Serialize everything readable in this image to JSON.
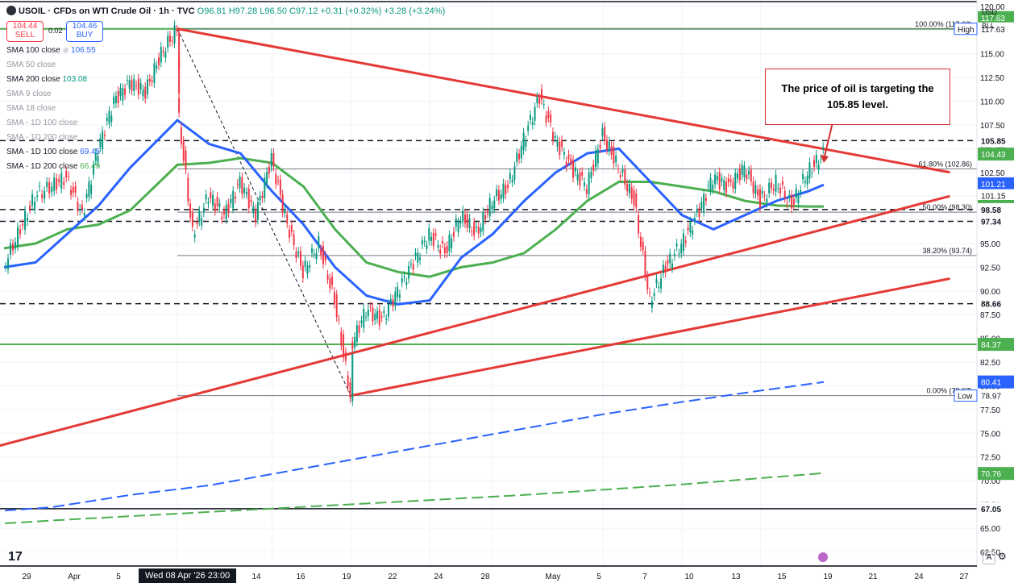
{
  "header": {
    "title": "USOIL · CFDs on WTI Crude Oil · 1h · TVC",
    "ohlc": "O96.81 H97.28 L96.50 C97.12 +0.31 (+0.32%) +3.28 (+3.24%)"
  },
  "trade": {
    "sell_price": "104.44",
    "sell_label": "SELL",
    "spread": "0.02",
    "buy_price": "104.46",
    "buy_label": "BUY"
  },
  "indicators": [
    {
      "label": "SMA 100 close",
      "value": "106.55",
      "style": "blue"
    },
    {
      "label": "SMA 50 close",
      "value": "",
      "style": "muted"
    },
    {
      "label": "SMA 200 close",
      "value": "103.08",
      "style": "green"
    },
    {
      "label": "SMA 9 close",
      "value": "",
      "style": "muted"
    },
    {
      "label": "SMA 18 close",
      "value": "",
      "style": "muted"
    },
    {
      "label": "SMA - 1D 100 close",
      "value": "",
      "style": "muted"
    },
    {
      "label": "SMA - 1D 200 close",
      "value": "",
      "style": "muted"
    },
    {
      "label": "SMA - 1D 100 close",
      "value": "69.45",
      "style": "blue"
    },
    {
      "label": "SMA - 1D 200 close",
      "value": "66.49",
      "style": "greenb"
    }
  ],
  "axis_units": [
    "USD",
    "BLL"
  ],
  "callout": "The price of oil is targeting the 105.85 level.",
  "date_badge": "Wed 08 Apr '26  23:00",
  "tv_logo": "17",
  "axis_button": "A",
  "colors": {
    "price_up": "#089981",
    "price_down": "#f23645",
    "sma_blue": "#2962ff",
    "sma_green": "#4caf50",
    "trendline": "#e53935",
    "axis_green": "#4caf50"
  },
  "chart_data": {
    "type": "line",
    "title": "USOIL · CFDs on WTI Crude Oil · 1h · TVC",
    "y_scale": "linear",
    "ylim": [
      61,
      120.5
    ],
    "y_ticks": [
      62.5,
      65.0,
      67.5,
      70.0,
      72.5,
      75.0,
      77.5,
      80.0,
      82.5,
      85.0,
      87.5,
      90.0,
      92.5,
      95.0,
      97.5,
      100.0,
      102.5,
      105.0,
      107.5,
      110.0,
      112.5,
      115.0,
      117.5,
      120.0
    ],
    "x_tick_labels": [
      "29",
      "Apr",
      "5",
      "14",
      "16",
      "19",
      "22",
      "24",
      "28",
      "May",
      "5",
      "7",
      "10",
      "13",
      "15",
      "19",
      "21",
      "24",
      "27"
    ],
    "price": [
      {
        "x": "Mar 28",
        "y": 92.5
      },
      {
        "x": "Mar 30",
        "y": 100.0
      },
      {
        "x": "Apr 1",
        "y": 102.0
      },
      {
        "x": "Apr 2",
        "y": 98.0
      },
      {
        "x": "Apr 3",
        "y": 105.0
      },
      {
        "x": "Apr 4",
        "y": 110.0
      },
      {
        "x": "Apr 5",
        "y": 112.0
      },
      {
        "x": "Apr 6",
        "y": 111.0
      },
      {
        "x": "Apr 7",
        "y": 115.0
      },
      {
        "x": "Apr 8",
        "y": 117.6
      },
      {
        "x": "Apr 8",
        "y": 110.0
      },
      {
        "x": "Apr 9",
        "y": 96.0
      },
      {
        "x": "Apr 10",
        "y": 100.0
      },
      {
        "x": "Apr 11",
        "y": 98.0
      },
      {
        "x": "Apr 12",
        "y": 101.5
      },
      {
        "x": "Apr 13",
        "y": 98.0
      },
      {
        "x": "Apr 14",
        "y": 104.0
      },
      {
        "x": "Apr 15",
        "y": 97.0
      },
      {
        "x": "Apr 16",
        "y": 92.0
      },
      {
        "x": "Apr 17",
        "y": 95.0
      },
      {
        "x": "Apr 18",
        "y": 89.0
      },
      {
        "x": "Apr 19",
        "y": 79.0
      },
      {
        "x": "Apr 19",
        "y": 84.0
      },
      {
        "x": "Apr 20",
        "y": 88.0
      },
      {
        "x": "Apr 21",
        "y": 87.0
      },
      {
        "x": "Apr 22",
        "y": 90.0
      },
      {
        "x": "Apr 23",
        "y": 93.0
      },
      {
        "x": "Apr 24",
        "y": 96.0
      },
      {
        "x": "Apr 25",
        "y": 94.0
      },
      {
        "x": "Apr 26",
        "y": 98.0
      },
      {
        "x": "Apr 27",
        "y": 96.0
      },
      {
        "x": "Apr 28",
        "y": 99.5
      },
      {
        "x": "Apr 29",
        "y": 101.0
      },
      {
        "x": "Apr 30",
        "y": 106.0
      },
      {
        "x": "May 1",
        "y": 110.5
      },
      {
        "x": "May 2",
        "y": 106.0
      },
      {
        "x": "May 3",
        "y": 103.0
      },
      {
        "x": "May 4",
        "y": 101.0
      },
      {
        "x": "May 5",
        "y": 106.5
      },
      {
        "x": "May 6",
        "y": 103.0
      },
      {
        "x": "May 7",
        "y": 99.5
      },
      {
        "x": "May 8",
        "y": 89.0
      },
      {
        "x": "May 9",
        "y": 92.5
      },
      {
        "x": "May 10",
        "y": 95.0
      },
      {
        "x": "May 11",
        "y": 98.0
      },
      {
        "x": "May 12",
        "y": 102.0
      },
      {
        "x": "May 13",
        "y": 101.0
      },
      {
        "x": "May 14",
        "y": 103.0
      },
      {
        "x": "May 15",
        "y": 99.5
      },
      {
        "x": "May 16",
        "y": 101.5
      },
      {
        "x": "May 17",
        "y": 99.0
      },
      {
        "x": "May 18",
        "y": 102.5
      },
      {
        "x": "May 19",
        "y": 104.4
      }
    ],
    "sma_100": [
      {
        "x": "Mar 28",
        "y": 92.5
      },
      {
        "x": "Mar 30",
        "y": 93.0
      },
      {
        "x": "Apr 1",
        "y": 96.0
      },
      {
        "x": "Apr 3",
        "y": 99.0
      },
      {
        "x": "Apr 5",
        "y": 103.0
      },
      {
        "x": "Apr 8",
        "y": 108.0
      },
      {
        "x": "Apr 10",
        "y": 105.5
      },
      {
        "x": "Apr 12",
        "y": 104.5
      },
      {
        "x": "Apr 14",
        "y": 100.5
      },
      {
        "x": "Apr 16",
        "y": 97.0
      },
      {
        "x": "Apr 18",
        "y": 92.5
      },
      {
        "x": "Apr 20",
        "y": 89.5
      },
      {
        "x": "Apr 22",
        "y": 88.6
      },
      {
        "x": "Apr 24",
        "y": 89.0
      },
      {
        "x": "Apr 26",
        "y": 93.5
      },
      {
        "x": "Apr 28",
        "y": 96.0
      },
      {
        "x": "Apr 30",
        "y": 99.5
      },
      {
        "x": "May 2",
        "y": 102.5
      },
      {
        "x": "May 4",
        "y": 104.5
      },
      {
        "x": "May 6",
        "y": 105.0
      },
      {
        "x": "May 8",
        "y": 101.5
      },
      {
        "x": "May 10",
        "y": 98.0
      },
      {
        "x": "May 12",
        "y": 96.5
      },
      {
        "x": "May 14",
        "y": 98.0
      },
      {
        "x": "May 16",
        "y": 99.5
      },
      {
        "x": "May 18",
        "y": 100.5
      },
      {
        "x": "May 19",
        "y": 101.2
      }
    ],
    "sma_200": [
      {
        "x": "Mar 28",
        "y": 94.5
      },
      {
        "x": "Mar 30",
        "y": 95.0
      },
      {
        "x": "Apr 1",
        "y": 96.5
      },
      {
        "x": "Apr 3",
        "y": 97.0
      },
      {
        "x": "Apr 5",
        "y": 98.5
      },
      {
        "x": "Apr 8",
        "y": 103.3
      },
      {
        "x": "Apr 10",
        "y": 103.5
      },
      {
        "x": "Apr 12",
        "y": 104.0
      },
      {
        "x": "Apr 14",
        "y": 103.5
      },
      {
        "x": "Apr 16",
        "y": 101.0
      },
      {
        "x": "Apr 18",
        "y": 96.5
      },
      {
        "x": "Apr 20",
        "y": 93.0
      },
      {
        "x": "Apr 22",
        "y": 92.0
      },
      {
        "x": "Apr 24",
        "y": 91.5
      },
      {
        "x": "Apr 26",
        "y": 92.5
      },
      {
        "x": "Apr 28",
        "y": 93.0
      },
      {
        "x": "Apr 30",
        "y": 94.0
      },
      {
        "x": "May 2",
        "y": 96.5
      },
      {
        "x": "May 4",
        "y": 99.5
      },
      {
        "x": "May 6",
        "y": 101.5
      },
      {
        "x": "May 8",
        "y": 101.5
      },
      {
        "x": "May 10",
        "y": 101.0
      },
      {
        "x": "May 12",
        "y": 100.5
      },
      {
        "x": "May 14",
        "y": 99.5
      },
      {
        "x": "May 16",
        "y": 99.0
      },
      {
        "x": "May 18",
        "y": 98.9
      },
      {
        "x": "May 19",
        "y": 98.9
      }
    ],
    "sma_1d_100": [
      {
        "x": "Mar 25",
        "y": 66.5
      },
      {
        "x": "Mar 31",
        "y": 67.2
      },
      {
        "x": "Apr 5",
        "y": 68.5
      },
      {
        "x": "Apr 10",
        "y": 69.5
      },
      {
        "x": "Apr 15",
        "y": 71.0
      },
      {
        "x": "Apr 20",
        "y": 72.5
      },
      {
        "x": "Apr 25",
        "y": 74.0
      },
      {
        "x": "Apr 30",
        "y": 75.5
      },
      {
        "x": "May 5",
        "y": 77.0
      },
      {
        "x": "May 10",
        "y": 78.3
      },
      {
        "x": "May 15",
        "y": 79.5
      },
      {
        "x": "May 19",
        "y": 80.4
      }
    ],
    "sma_1d_200": [
      {
        "x": "Mar 25",
        "y": 65.2
      },
      {
        "x": "Apr 1",
        "y": 65.9
      },
      {
        "x": "Apr 10",
        "y": 66.7
      },
      {
        "x": "Apr 20",
        "y": 67.6
      },
      {
        "x": "Apr 30",
        "y": 68.5
      },
      {
        "x": "May 10",
        "y": 69.6
      },
      {
        "x": "May 19",
        "y": 70.8
      }
    ],
    "trendlines": [
      {
        "from": {
          "x": "Apr 8",
          "y": 117.63
        },
        "to": {
          "x": "May 27",
          "y": 102.5
        }
      },
      {
        "from": {
          "x": "Mar 25",
          "y": 72.5
        },
        "to": {
          "x": "May 27",
          "y": 100.0
        }
      },
      {
        "from": {
          "x": "Apr 19",
          "y": 78.97
        },
        "to": {
          "x": "May 27",
          "y": 91.3
        }
      }
    ],
    "horizontal_levels": [
      {
        "y": 117.63,
        "style": "green"
      },
      {
        "y": 105.85,
        "style": "dashed"
      },
      {
        "y": 98.58,
        "style": "dashed"
      },
      {
        "y": 97.34,
        "style": "dashed"
      },
      {
        "y": 88.66,
        "style": "dashed"
      },
      {
        "y": 84.37,
        "style": "green"
      },
      {
        "y": 67.05,
        "style": "solid"
      },
      {
        "y": 120.5,
        "style": "solid"
      },
      {
        "y": 61.0,
        "style": "solid"
      }
    ],
    "fib_levels": [
      {
        "y": 117.63,
        "label": "100.00% (117.63)"
      },
      {
        "y": 102.86,
        "label": "61.80% (102.86)"
      },
      {
        "y": 98.3,
        "label": "50.00% (98.30)"
      },
      {
        "y": 93.74,
        "label": "38.20% (93.74)"
      },
      {
        "y": 78.97,
        "label": "0.00% (78.97)"
      }
    ],
    "price_badges": [
      {
        "y": 117.63,
        "label": "117.63",
        "color": "#4caf50",
        "text_color": "#ffffff"
      },
      {
        "y": 117.63,
        "label": "117.63",
        "tag": "High",
        "color": "#ffffff",
        "text_color": "#131722"
      },
      {
        "y": 105.85,
        "label": "105.85",
        "color": "#ffffff",
        "text_color": "#131722",
        "bold": true
      },
      {
        "y": 104.43,
        "label": "104.43",
        "color": "#4caf50",
        "text_color": "#ffffff"
      },
      {
        "y": 101.21,
        "label": "101.21",
        "color": "#2962ff",
        "text_color": "#ffffff"
      },
      {
        "y": 101.15,
        "label": "101.15",
        "color": "#ffffff",
        "text_color": "#131722"
      },
      {
        "y": 98.91,
        "label": "98.91",
        "color": "#4caf50",
        "text_color": "#ffffff"
      },
      {
        "y": 98.58,
        "label": "98.58",
        "color": "#ffffff",
        "text_color": "#131722",
        "bold": true
      },
      {
        "y": 97.34,
        "label": "97.34",
        "color": "#ffffff",
        "text_color": "#131722",
        "bold": true
      },
      {
        "y": 88.66,
        "label": "88.66",
        "color": "#ffffff",
        "text_color": "#131722",
        "bold": true
      },
      {
        "y": 84.37,
        "label": "84.37",
        "color": "#4caf50",
        "text_color": "#ffffff"
      },
      {
        "y": 80.41,
        "label": "80.41",
        "color": "#2962ff",
        "text_color": "#ffffff"
      },
      {
        "y": 78.97,
        "label": "78.97",
        "tag": "Low",
        "color": "#ffffff",
        "text_color": "#131722"
      },
      {
        "y": 70.76,
        "label": "70.76",
        "color": "#4caf50",
        "text_color": "#ffffff"
      },
      {
        "y": 67.05,
        "label": "67.05",
        "color": "#ffffff",
        "text_color": "#131722",
        "bold": true
      }
    ]
  }
}
